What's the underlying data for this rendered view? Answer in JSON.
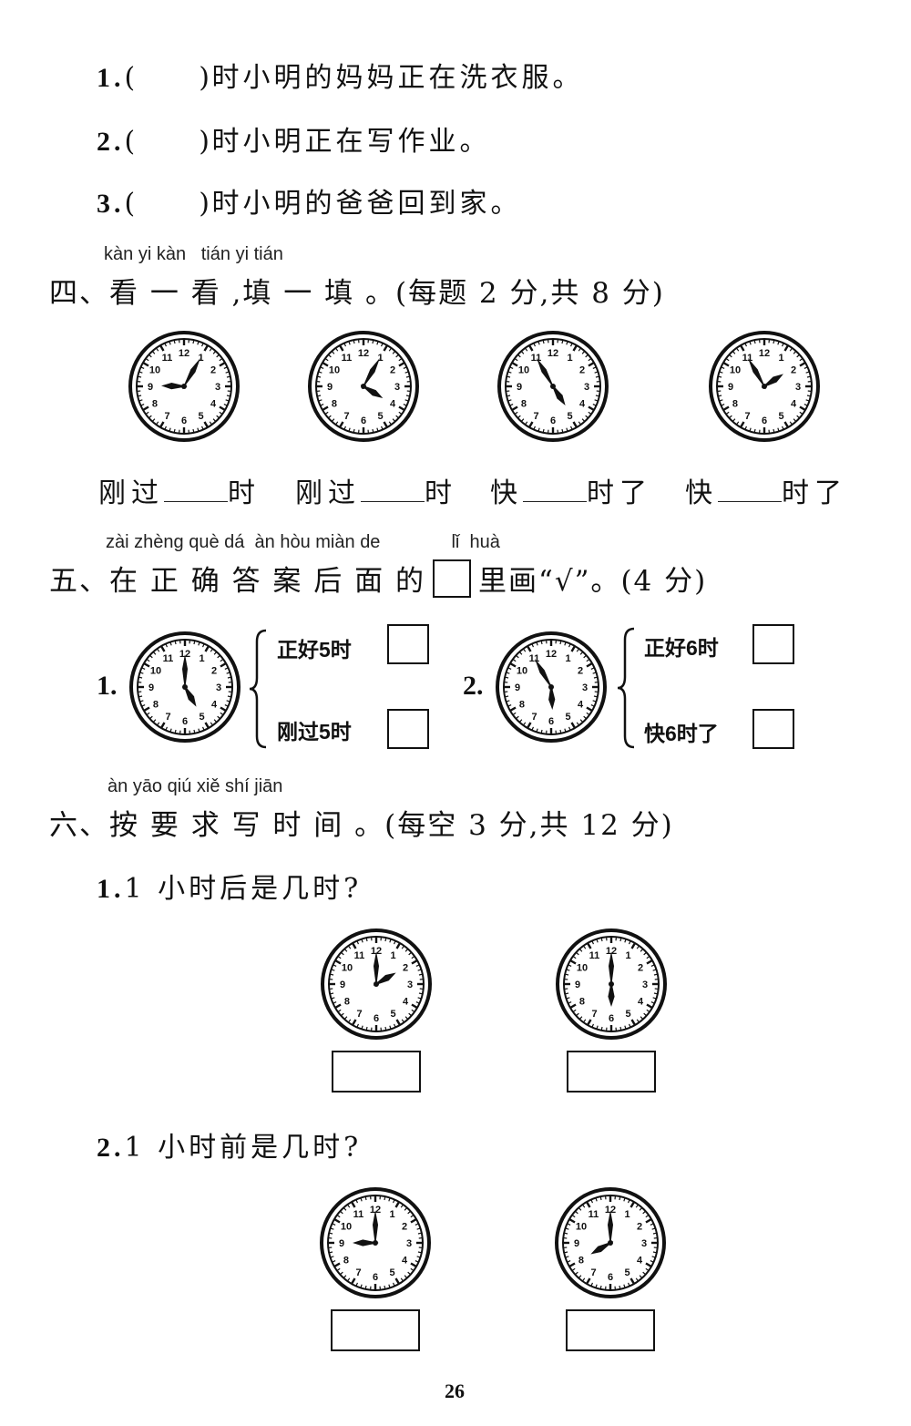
{
  "section3_items": [
    {
      "num": "1.",
      "paren": "(",
      "close": ")",
      "text": "时小明的妈妈正在洗衣服。"
    },
    {
      "num": "2.",
      "paren": "(",
      "close": ")",
      "text": "时小明正在写作业。"
    },
    {
      "num": "3.",
      "paren": "(",
      "close": ")",
      "text": "时小明的爸爸回到家。"
    }
  ],
  "section4": {
    "pinyin": [
      "kàn",
      "yi",
      "kàn",
      "tián",
      "yi",
      "tián"
    ],
    "heading_prefix": "四、看 一 看 ,填 一 填 。",
    "heading_score": "(每题 2 分,共 8 分)",
    "clocks": [
      {
        "hour": 9.05,
        "minute": 5
      },
      {
        "hour": 4.05,
        "minute": 5
      },
      {
        "hour": 4.9,
        "minute": 55
      },
      {
        "hour": 1.9,
        "minute": 55
      }
    ],
    "fills": [
      {
        "before": "刚过",
        "after": "时"
      },
      {
        "before": "刚过",
        "after": "时"
      },
      {
        "before": "快",
        "after": "时了"
      },
      {
        "before": "快",
        "after": "时了"
      }
    ]
  },
  "section5": {
    "pinyin": [
      "zài",
      "zhèng",
      "què",
      "dá",
      "àn",
      "hòu",
      "miàn",
      "de",
      "lǐ",
      "huà"
    ],
    "heading_prefix": "五、在 正 确 答 案 后 面 的",
    "heading_suffix": "里画“√”。",
    "heading_score": "(4 分)",
    "items": [
      {
        "num": "1.",
        "clock": {
          "hour": 5.0,
          "minute": 0
        },
        "options": [
          "正好5时",
          "刚过5时"
        ]
      },
      {
        "num": "2.",
        "clock": {
          "hour": 5.9,
          "minute": 55
        },
        "options": [
          "正好6时",
          "快6时了"
        ]
      }
    ]
  },
  "section6": {
    "pinyin": [
      "àn",
      "yāo",
      "qiú",
      "xiě",
      "shí",
      "jiān"
    ],
    "heading_prefix": "六、按 要 求 写 时 间 。",
    "heading_score": "(每空 3 分,共 12 分)",
    "sub1": {
      "num": "1.",
      "text": "1 小时后是几时?",
      "clocks": [
        {
          "hour": 2,
          "minute": 0
        },
        {
          "hour": 6,
          "minute": 0
        }
      ]
    },
    "sub2": {
      "num": "2.",
      "text": "1 小时前是几时?",
      "clocks": [
        {
          "hour": 9,
          "minute": 0
        },
        {
          "hour": 8,
          "minute": 0
        }
      ]
    }
  },
  "page_number": "26"
}
